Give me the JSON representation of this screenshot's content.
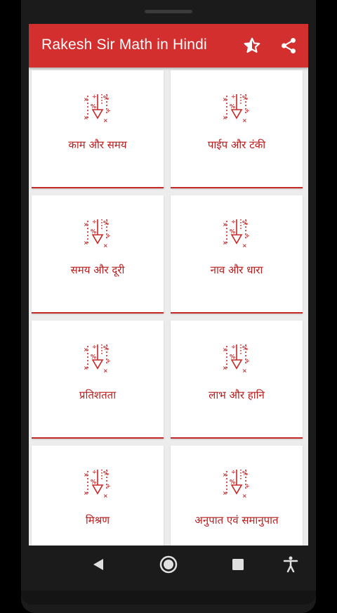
{
  "app": {
    "title": "Rakesh Sir Math in Hindi",
    "accent_color": "#d32f2f",
    "actions": [
      {
        "icon": "star-half-icon"
      },
      {
        "icon": "share-icon"
      }
    ]
  },
  "topics": [
    {
      "label": "काम और समय",
      "icon": "math-symbols-icon"
    },
    {
      "label": "पाईप और टंकी",
      "icon": "math-symbols-icon"
    },
    {
      "label": "समय और दूरी",
      "icon": "math-symbols-icon"
    },
    {
      "label": "नाव और धारा",
      "icon": "math-symbols-icon"
    },
    {
      "label": "प्रतिशतता",
      "icon": "math-symbols-icon"
    },
    {
      "label": "लाभ और हानि",
      "icon": "math-symbols-icon"
    },
    {
      "label": "मिश्रण",
      "icon": "math-symbols-icon"
    },
    {
      "label": "अनुपात एवं समानुपात",
      "icon": "math-symbols-icon"
    }
  ],
  "navigation": [
    {
      "icon": "back-triangle-icon"
    },
    {
      "icon": "home-circle-icon"
    },
    {
      "icon": "recents-square-icon"
    },
    {
      "icon": "accessibility-icon"
    }
  ]
}
